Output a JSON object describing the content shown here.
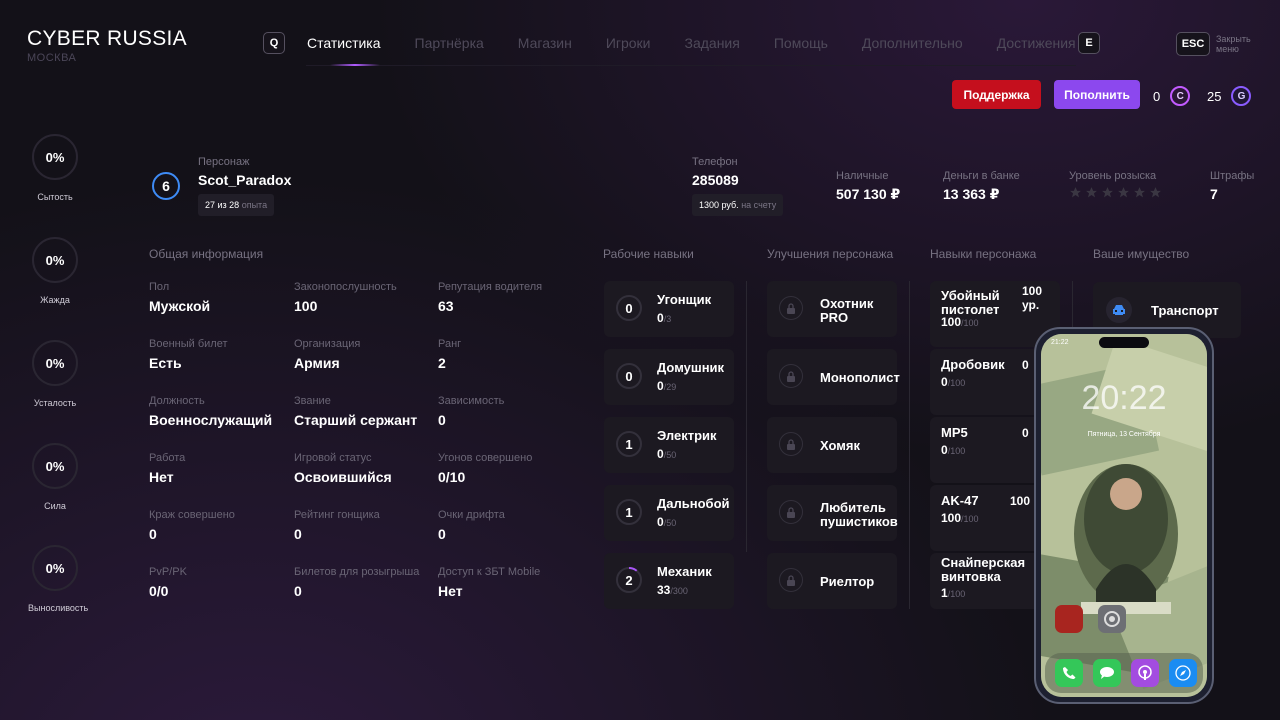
{
  "brand": {
    "title": "CYBER RUSSIA",
    "city": "МОСКВА"
  },
  "nav": {
    "key_left": "Q",
    "key_right": "E",
    "items": [
      "Статистика",
      "Партнёрка",
      "Магазин",
      "Игроки",
      "Задания",
      "Помощь",
      "Дополнительно",
      "Достижения"
    ],
    "active": 0
  },
  "esc": {
    "key": "ESC",
    "label_1": "Закрыть",
    "label_2": "меню"
  },
  "actions": {
    "support": "Поддержка",
    "topup": "Пополнить"
  },
  "currency": {
    "c_value": "0",
    "c_symbol": "C",
    "g_value": "25",
    "g_symbol": "G",
    "c_color": "#c25bff",
    "g_color": "#8a5cff"
  },
  "needs": [
    {
      "value": "0%",
      "label": "Сытость"
    },
    {
      "value": "0%",
      "label": "Жажда"
    },
    {
      "value": "0%",
      "label": "Усталость"
    },
    {
      "value": "0%",
      "label": "Сила"
    },
    {
      "value": "0%",
      "label": "Выносливость"
    }
  ],
  "character": {
    "level": "6",
    "label": "Персонаж",
    "name": "Scot_Paradox",
    "exp": "27 из 28",
    "exp_suffix": "опыта"
  },
  "phone_num": {
    "label": "Телефон",
    "value": "285089",
    "balance": "1300 руб.",
    "balance_suffix": "на счету"
  },
  "money": {
    "cash_label": "Наличные",
    "cash": "507 130 ₽",
    "bank_label": "Деньги в банке",
    "bank": "13 363 ₽",
    "wanted_label": "Уровень розыска",
    "wanted_stars": 0,
    "wanted_max": 6,
    "fines_label": "Штрафы",
    "fines": "7"
  },
  "sections": {
    "general": "Общая информация",
    "work": "Рабочие навыки",
    "upgrades": "Улучшения персонажа",
    "char_skills": "Навыки персонажа",
    "property": "Ваше имущество"
  },
  "general": [
    {
      "label": "Пол",
      "value": "Мужской"
    },
    {
      "label": "Законопослушность",
      "value": "100"
    },
    {
      "label": "Репутация водителя",
      "value": "63"
    },
    {
      "label": "Военный билет",
      "value": "Есть"
    },
    {
      "label": "Организация",
      "value": "Армия"
    },
    {
      "label": "Ранг",
      "value": "2"
    },
    {
      "label": "Должность",
      "value": "Военнослужащий"
    },
    {
      "label": "Звание",
      "value": "Старший сержант"
    },
    {
      "label": "Зависимость",
      "value": "0"
    },
    {
      "label": "Работа",
      "value": "Нет"
    },
    {
      "label": "Игровой статус",
      "value": "Освоившийся"
    },
    {
      "label": "Угонов совершено",
      "value": "0/10"
    },
    {
      "label": "Краж совершено",
      "value": "0"
    },
    {
      "label": "Рейтинг гонщика",
      "value": "0"
    },
    {
      "label": "Очки дрифта",
      "value": "0"
    },
    {
      "label": "PvP/PK",
      "value": "0/0"
    },
    {
      "label": "Билетов для розыгрыша",
      "value": "0"
    },
    {
      "label": "Доступ к ЗБТ Mobile",
      "value": "Нет"
    }
  ],
  "work_skills": [
    {
      "level": "0",
      "name": "Угонщик",
      "progress": "0",
      "max": "/3"
    },
    {
      "level": "0",
      "name": "Домушник",
      "progress": "0",
      "max": "/29"
    },
    {
      "level": "1",
      "name": "Электрик",
      "progress": "0",
      "max": "/50"
    },
    {
      "level": "1",
      "name": "Дальнобой",
      "progress": "0",
      "max": "/50"
    },
    {
      "level": "2",
      "name": "Механик",
      "progress": "33",
      "max": "/300",
      "fill": 0.11
    }
  ],
  "upgrades": [
    {
      "line1": "Охотник",
      "line2": "PRO"
    },
    {
      "line1": "Монополист",
      "line2": ""
    },
    {
      "line1": "Хомяк",
      "line2": ""
    },
    {
      "line1": "Любитель",
      "line2": "пушистиков"
    },
    {
      "line1": "Риелтор",
      "line2": ""
    }
  ],
  "char_skills": [
    {
      "line1": "Убойный",
      "line2": "пистолет",
      "value": "100",
      "max": "/100",
      "right1": "100",
      "right2": "ур."
    },
    {
      "line1": "Дробовик",
      "line2": "",
      "value": "0",
      "max": "/100",
      "right1": "0",
      "right2": ""
    },
    {
      "line1": "MP5",
      "line2": "",
      "value": "0",
      "max": "/100",
      "right1": "0",
      "right2": ""
    },
    {
      "line1": "AK-47",
      "line2": "",
      "value": "100",
      "max": "/100",
      "right1": "100",
      "right2": ""
    },
    {
      "line1": "Снайперская",
      "line2": "винтовка",
      "value": "1",
      "max": "/100",
      "right1": "",
      "right2": ""
    }
  ],
  "property": {
    "transport": "Транспорт",
    "icon": "car-icon"
  },
  "phone": {
    "time": "21:22",
    "clock": "20:22",
    "date": "Пятница, 13 Сентября"
  }
}
